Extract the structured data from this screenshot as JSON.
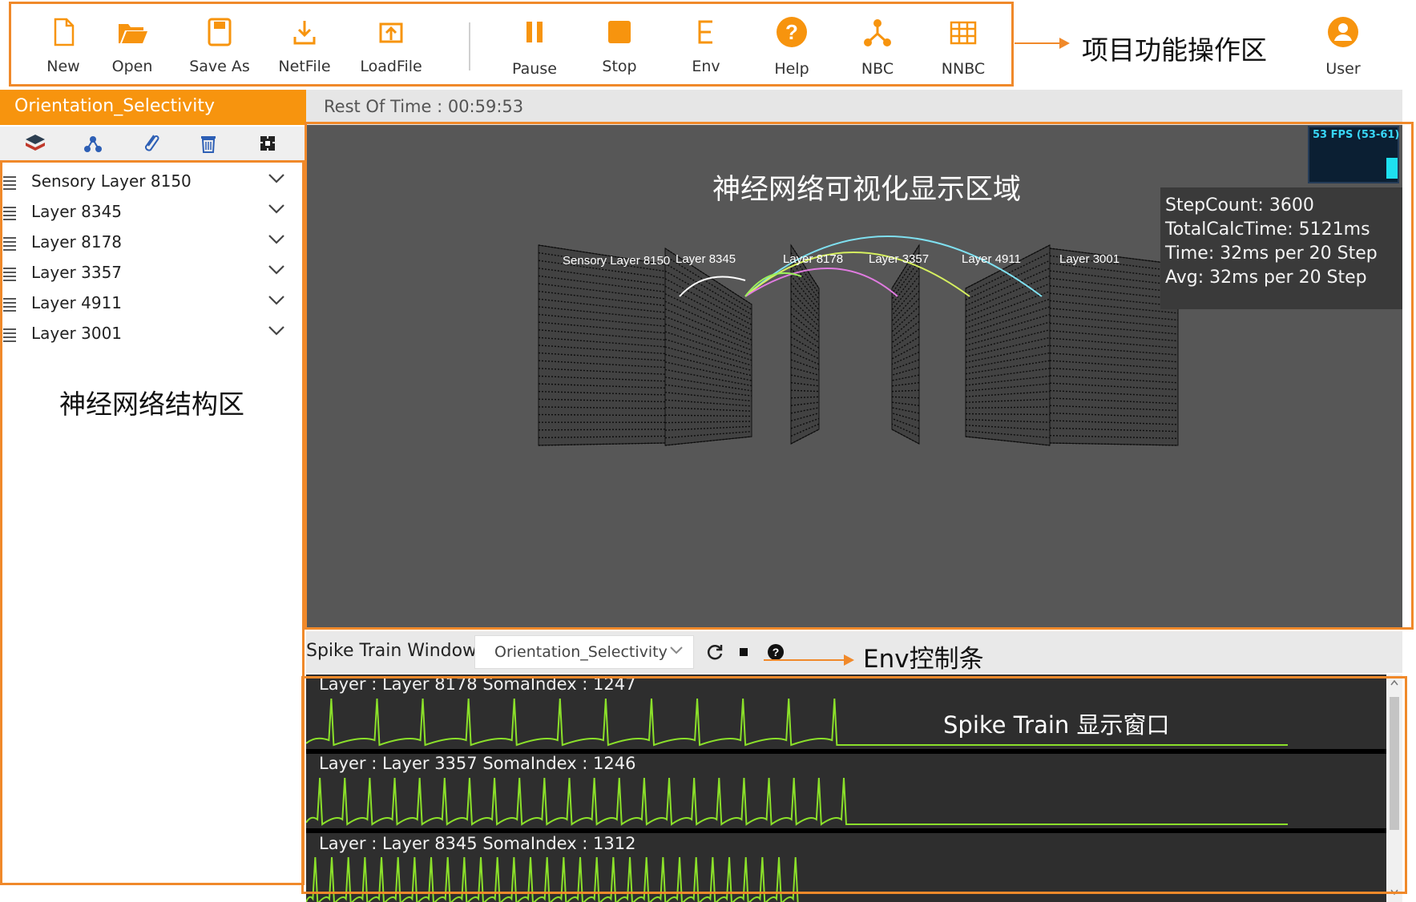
{
  "toolbar": {
    "items": [
      {
        "label": "New",
        "icon": "new-file-icon"
      },
      {
        "label": "Open",
        "icon": "open-folder-icon"
      },
      {
        "label": "Save As",
        "icon": "save-icon"
      },
      {
        "label": "NetFile",
        "icon": "download-icon"
      },
      {
        "label": "LoadFile",
        "icon": "upload-icon"
      },
      {
        "label": "Pause",
        "icon": "pause-icon"
      },
      {
        "label": "Stop",
        "icon": "stop-icon"
      },
      {
        "label": "Env",
        "icon": "env-icon"
      },
      {
        "label": "Help",
        "icon": "help-icon"
      },
      {
        "label": "NBC",
        "icon": "network-icon"
      },
      {
        "label": "NNBC",
        "icon": "grid-icon"
      },
      {
        "label": "User",
        "icon": "user-icon"
      }
    ],
    "accent": "#f7940e"
  },
  "annotations": {
    "toolbar_zone": "项目功能操作区",
    "structure_zone": "神经网络结构区",
    "visual_zone": "神经网络可视化显示区域",
    "env_bar": "Env控制条",
    "spike_zone": "Spike Train 显示窗口"
  },
  "sidebar": {
    "project_name": "Orientation_Selectivity",
    "tools": [
      "layers-icon",
      "connect-icon",
      "link-icon",
      "trash-icon",
      "fit-icon"
    ],
    "layers": [
      {
        "label": "Sensory Layer 8150"
      },
      {
        "label": "Layer 8345"
      },
      {
        "label": "Layer 8178"
      },
      {
        "label": "Layer 3357"
      },
      {
        "label": "Layer 4911"
      },
      {
        "label": "Layer 3001"
      }
    ]
  },
  "header": {
    "rest_of_time": "Rest Of Time : 00:59:53"
  },
  "viewport": {
    "fps": "53 FPS (53-61)",
    "stats": [
      "StepCount: 3600",
      "TotalCalcTime: 5121ms",
      "Time: 32ms per 20 Step",
      "Avg: 32ms per 20 Step"
    ],
    "scene_labels": [
      "Sensory Layer 8150",
      "Layer 8345",
      "Layer 8178",
      "Layer 3357",
      "Layer 4911",
      "Layer 3001"
    ],
    "connection_colors": [
      "#7fe0f0",
      "#d6f060",
      "#e07be0",
      "#9cf05a",
      "#ffffff"
    ]
  },
  "spike_window": {
    "title": "Spike Train Window",
    "selected_env": "Orientation_Selectivity",
    "refresh_icon": "refresh-icon",
    "stop_icon": "stop-square-icon",
    "help_icon": "help-circle-icon",
    "trace_color": "#8be02a",
    "traces": [
      {
        "label": "Layer : Layer 8178   SomaIndex : 1247",
        "spikes": 12
      },
      {
        "label": "Layer : Layer 3357   SomaIndex : 1246",
        "spikes": 22
      },
      {
        "label": "Layer : Layer 8345   SomaIndex : 1312",
        "spikes": 30
      }
    ]
  }
}
